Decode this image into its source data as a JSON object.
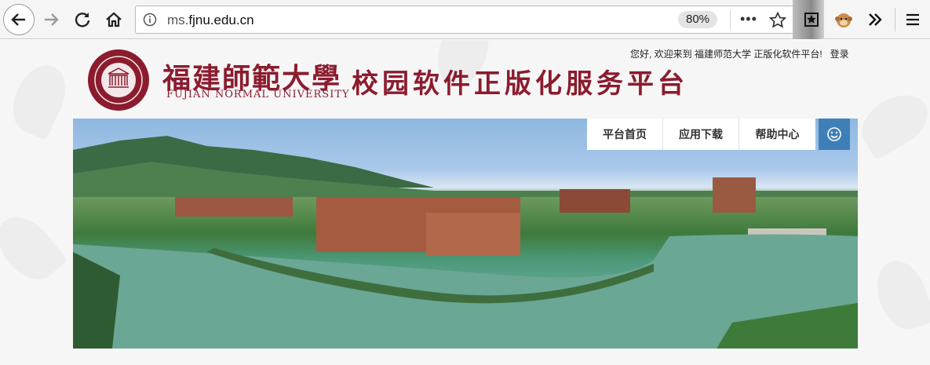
{
  "browser": {
    "url_prefix": "ms.",
    "url_domain": "fjnu.edu.cn",
    "zoom": "80%"
  },
  "header": {
    "logo_name": "福建師範大學",
    "logo_en": "FUJIAN NORMAL UNIVERSITY",
    "title": "校园软件正版化服务平台",
    "welcome": "您好, 欢迎来到 福建师范大学 正版化软件平台!",
    "login": "登录"
  },
  "nav": {
    "items": [
      "平台首页",
      "应用下载",
      "帮助中心"
    ]
  },
  "colors": {
    "brand": "#8b1c2e",
    "accent": "#3f7fb8"
  }
}
